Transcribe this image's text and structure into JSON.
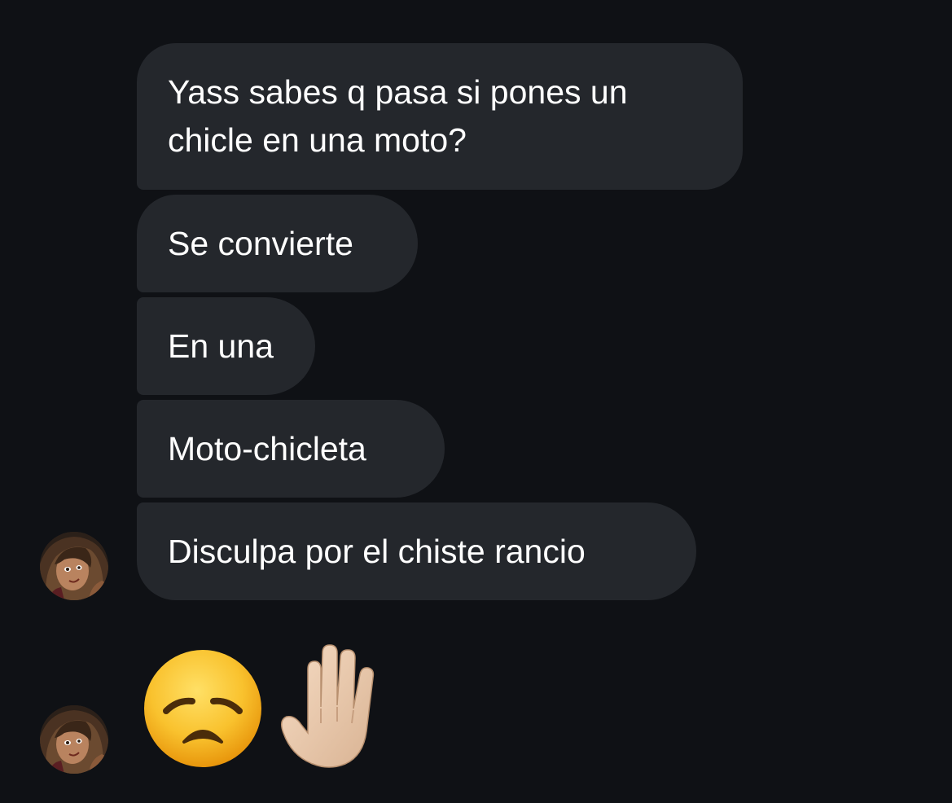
{
  "conversation": {
    "messages": [
      {
        "text": "Yass sabes q pasa si pones un\nchicle en una moto?"
      },
      {
        "text": "Se convierte"
      },
      {
        "text": "En una"
      },
      {
        "text": "Moto-chicleta"
      },
      {
        "text": "Disculpa por el chiste rancio"
      }
    ],
    "emoji_message": {
      "emojis": [
        "disappointed-face",
        "raised-hand-light-skin-tone"
      ]
    }
  },
  "colors": {
    "background": "#0f1115",
    "bubble": "#24272c",
    "text": "#ffffff"
  }
}
